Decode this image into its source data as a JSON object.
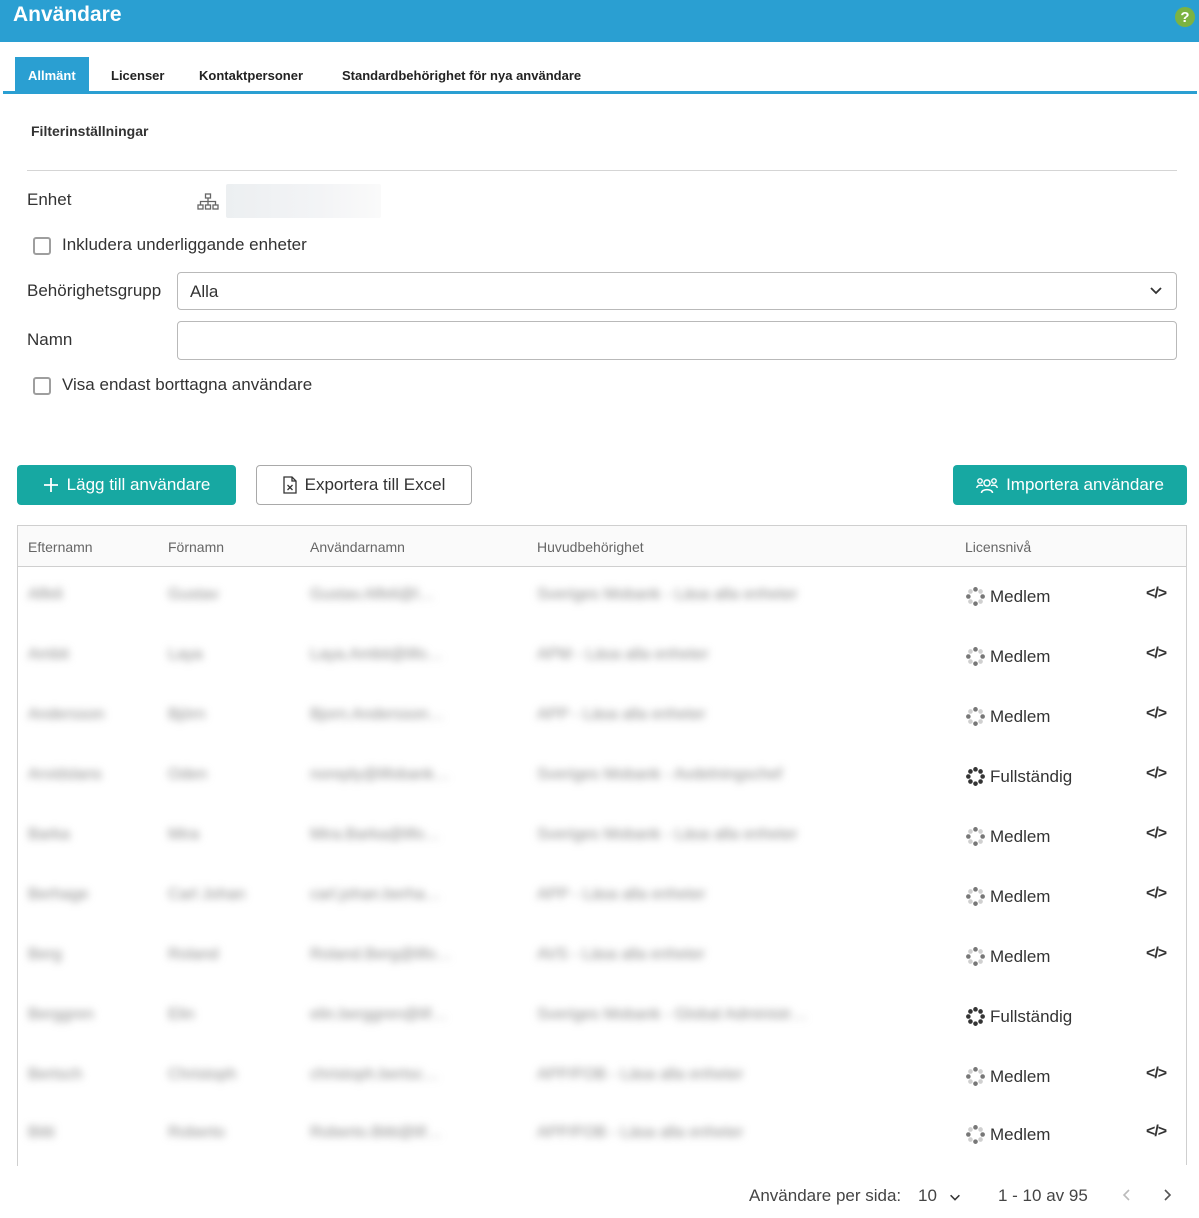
{
  "header": {
    "title": "Användare",
    "help_glyph": "?"
  },
  "tabs": [
    {
      "label": "Allmänt",
      "active": true
    },
    {
      "label": "Licenser",
      "active": false
    },
    {
      "label": "Kontaktpersoner",
      "active": false
    },
    {
      "label": "Standardbehörighet för nya användare",
      "active": false
    }
  ],
  "filters": {
    "section_title": "Filterinställningar",
    "unit_label": "Enhet",
    "include_sub_label": "Inkludera underliggande enheter",
    "include_sub_checked": false,
    "group_label": "Behörighetsgrupp",
    "group_value": "Alla",
    "name_label": "Namn",
    "name_value": "",
    "deleted_only_label": "Visa endast borttagna användare",
    "deleted_only_checked": false
  },
  "actions": {
    "add_user": "Lägg till användare",
    "export_excel": "Exportera till Excel",
    "import_users": "Importera användare"
  },
  "table": {
    "columns": [
      "Efternamn",
      "Förnamn",
      "Användarnamn",
      "Huvudbehörighet",
      "Licensnivå"
    ],
    "rows": [
      {
        "last": "Alfeli",
        "first": "Gustav",
        "user": "Gustav.Alfeli@l…",
        "role": "Sveriges Mobank - Läsa alla enheter",
        "license": "Medlem",
        "embed": true
      },
      {
        "last": "Ambit",
        "first": "Laya",
        "user": "Laya.Ambit@lifo…",
        "role": "APM - Läsa alla enheter",
        "license": "Medlem",
        "embed": true
      },
      {
        "last": "Andersson",
        "first": "Björn",
        "user": "Bjorn.Andersson…",
        "role": "APP - Läsa alla enheter",
        "license": "Medlem",
        "embed": true
      },
      {
        "last": "Arvidslans",
        "first": "Oden",
        "user": "noreply@lifobank…",
        "role": "Sveriges Mobank - Avdelningschef",
        "license": "Fullständig",
        "embed": true
      },
      {
        "last": "Barka",
        "first": "Mira",
        "user": "Mira.Barka@lifo…",
        "role": "Sveriges Mobank - Läsa alla enheter",
        "license": "Medlem",
        "embed": true
      },
      {
        "last": "Berhage",
        "first": "Carl Johan",
        "user": "carl.johan.berha…",
        "role": "APP - Läsa alla enheter",
        "license": "Medlem",
        "embed": true
      },
      {
        "last": "Berg",
        "first": "Roland",
        "user": "Roland.Berg@lifo…",
        "role": "AVS - Läsa alla enheter",
        "license": "Medlem",
        "embed": true
      },
      {
        "last": "Berggren",
        "first": "Elin",
        "user": "elin.berggren@lif…",
        "role": "Sveriges Mobank - Global Administr…",
        "license": "Fullständig",
        "embed": false
      },
      {
        "last": "Bertsch",
        "first": "Christoph",
        "user": "christoph.bertsc…",
        "role": "APP/FOB - Läsa alla enheter",
        "license": "Medlem",
        "embed": true
      },
      {
        "last": "Bitti",
        "first": "Roberto",
        "user": "Roberto.Bitti@lif…",
        "role": "APP/FOB - Läsa alla enheter",
        "license": "Medlem",
        "embed": true
      }
    ]
  },
  "pagination": {
    "per_page_label": "Användare per sida:",
    "per_page_value": "10",
    "range_text": "1 - 10 av 95"
  },
  "icons": {
    "help": "help-icon",
    "unit": "org-tree-icon",
    "dropdown": "chevron-down-icon",
    "add": "plus-icon",
    "excel": "excel-file-icon",
    "import": "user-group-icon",
    "license": "spinner-icon",
    "embed": "code-icon",
    "prev": "chevron-left-icon",
    "next": "chevron-right-icon"
  },
  "colors": {
    "header": "#2a9fd2",
    "primary_button": "#17a8a2",
    "help": "#7cb342"
  }
}
